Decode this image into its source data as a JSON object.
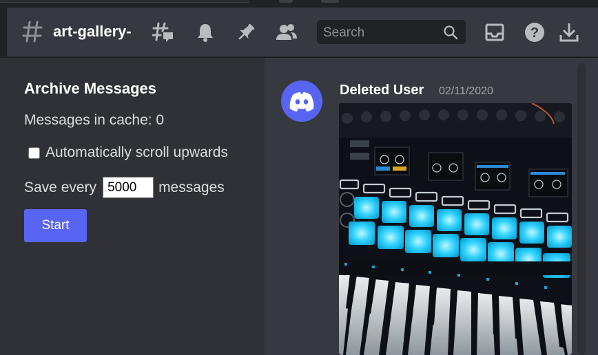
{
  "header": {
    "channel_name": "art-gallery-",
    "search_placeholder": "Search",
    "icons": [
      "hash-icon",
      "threads-icon",
      "bell-icon",
      "pin-icon",
      "members-icon",
      "search-icon",
      "inbox-icon",
      "help-icon",
      "download-icon"
    ]
  },
  "archive": {
    "title": "Archive Messages",
    "cache_label": "Messages in cache: 0",
    "auto_scroll_label": "Automatically scroll upwards",
    "auto_scroll_checked": false,
    "save_prefix": "Save every",
    "save_value": "5000",
    "save_suffix": "messages",
    "start_label": "Start"
  },
  "message": {
    "author": "Deleted User",
    "timestamp": "02/11/2020",
    "avatar_icon": "discord-logo-icon",
    "attachment": "photo of a midi controller with glowing cyan pads and keyboard"
  },
  "colors": {
    "brand": "#5865f2",
    "header_bg": "#36393f",
    "panel_bg": "#2f3136",
    "pad_glow": "#2ad4ff"
  }
}
